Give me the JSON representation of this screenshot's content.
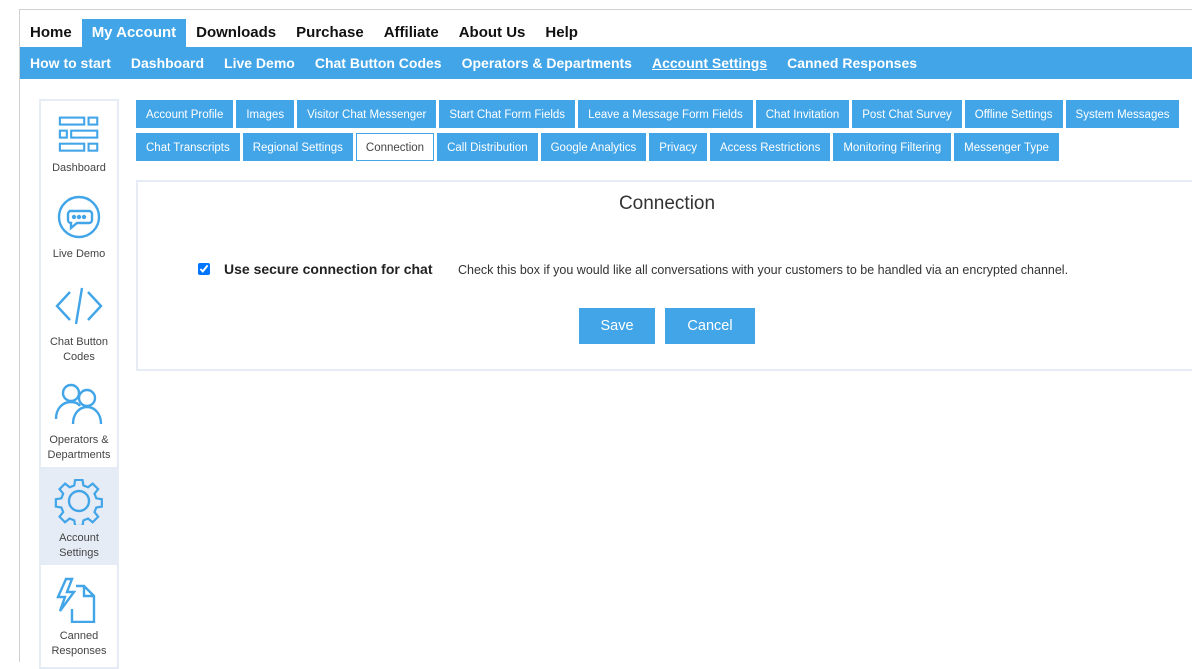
{
  "top_nav": [
    {
      "label": "Home"
    },
    {
      "label": "My Account",
      "active": true
    },
    {
      "label": "Downloads"
    },
    {
      "label": "Purchase"
    },
    {
      "label": "Affiliate"
    },
    {
      "label": "About Us"
    },
    {
      "label": "Help"
    }
  ],
  "sub_nav": [
    {
      "label": "How to start"
    },
    {
      "label": "Dashboard"
    },
    {
      "label": "Live Demo"
    },
    {
      "label": "Chat Button Codes"
    },
    {
      "label": "Operators & Departments"
    },
    {
      "label": "Account Settings",
      "active": true
    },
    {
      "label": "Canned Responses"
    }
  ],
  "sidebar": [
    {
      "label": "Dashboard",
      "icon": "dashboard-icon"
    },
    {
      "label": "Live Demo",
      "icon": "chat-bubble-icon"
    },
    {
      "label": "Chat Button Codes",
      "icon": "code-icon"
    },
    {
      "label": "Operators & Departments",
      "icon": "users-icon"
    },
    {
      "label": "Account Settings",
      "icon": "gear-icon",
      "active": true
    },
    {
      "label": "Canned Responses",
      "icon": "canned-responses-icon"
    }
  ],
  "tabs_row1": [
    "Account Profile",
    "Images",
    "Visitor Chat Messenger",
    "Start Chat Form Fields",
    "Leave a Message Form Fields",
    "Chat Invitation",
    "Post Chat Survey",
    "Offline Settings",
    "System Messages"
  ],
  "tabs_row2": [
    "Chat Transcripts",
    "Regional Settings",
    "Connection",
    "Call Distribution",
    "Google Analytics",
    "Privacy",
    "Access Restrictions",
    "Monitoring Filtering",
    "Messenger Type"
  ],
  "active_tab": "Connection",
  "panel": {
    "title": "Connection",
    "checkbox_label": "Use secure connection for chat",
    "checkbox_checked": true,
    "help": "Check this box if you would like all conversations with your customers to be handled via an encrypted channel.",
    "save": "Save",
    "cancel": "Cancel"
  },
  "colors": {
    "accent": "#42a5e8",
    "sidebar_active": "#e6ecf6"
  }
}
